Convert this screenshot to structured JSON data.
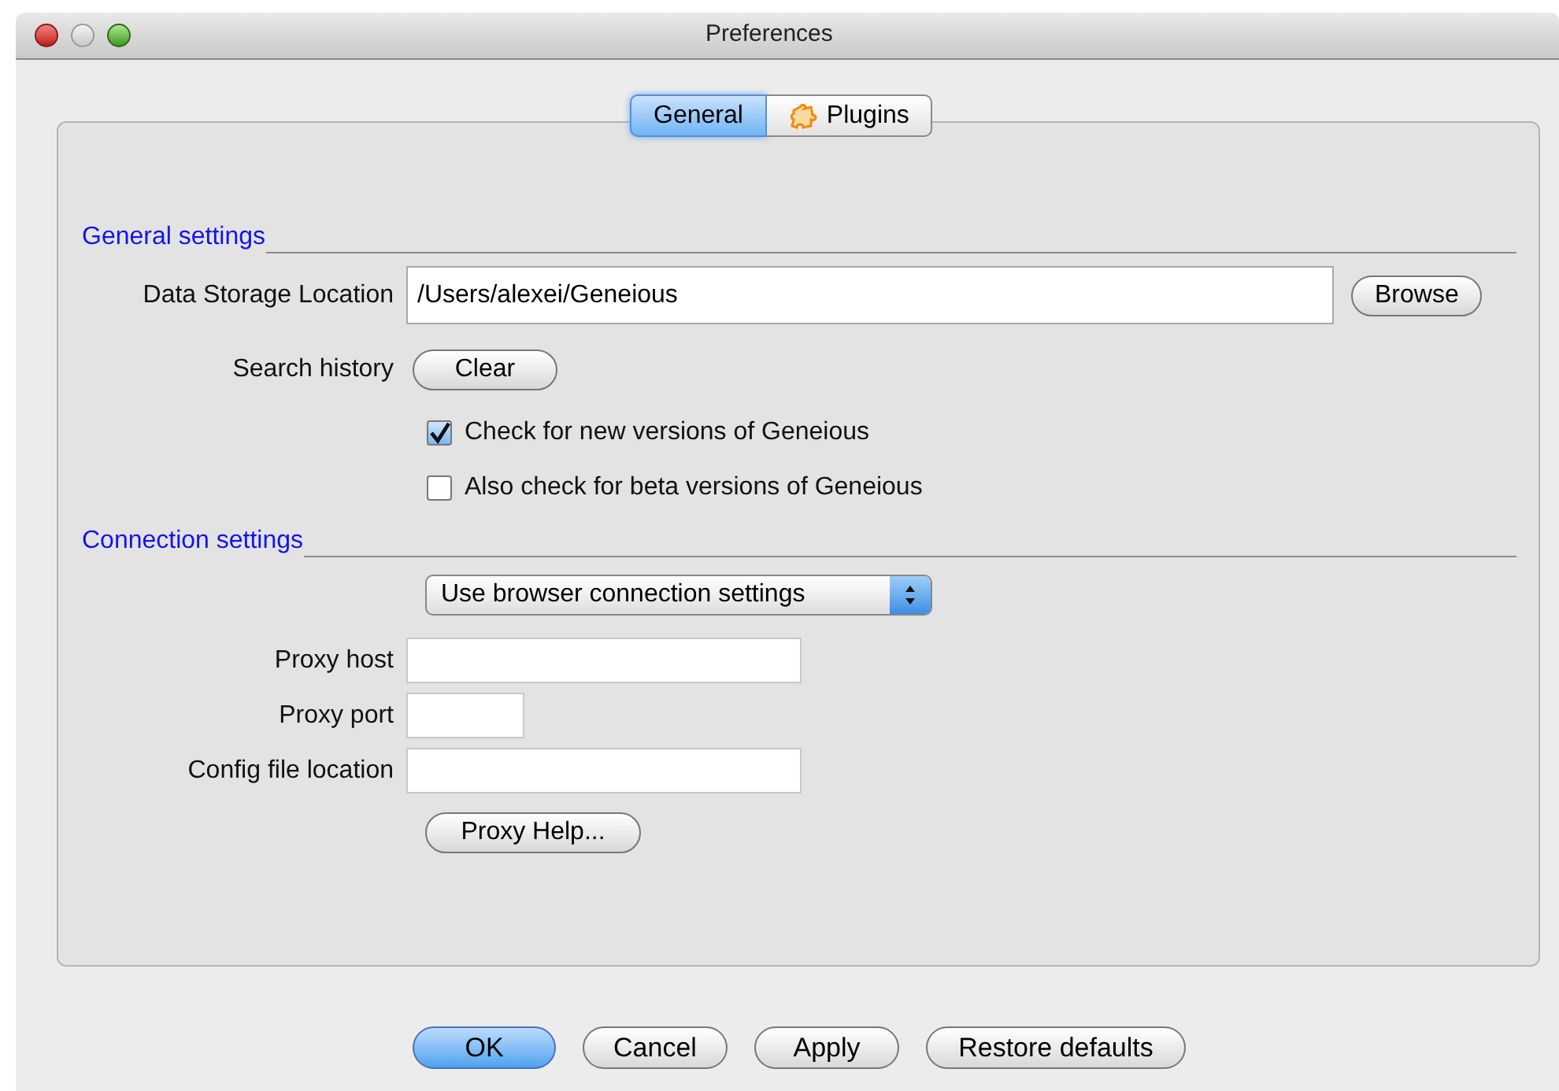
{
  "window": {
    "title": "Preferences"
  },
  "tabs": [
    {
      "label": "General",
      "selected": true,
      "kind": "plain"
    },
    {
      "label": "Plugins",
      "selected": false,
      "kind": "plugin"
    }
  ],
  "general_settings": {
    "heading": "General settings",
    "data_storage": {
      "label": "Data Storage Location",
      "value": "/Users/alexei/Geneious"
    },
    "browse_button": "Browse",
    "search_history": {
      "label": "Search history",
      "button": "Clear"
    },
    "checkboxes": [
      {
        "label": "Check for new versions of Geneious",
        "checked": true
      },
      {
        "label": "Also check for beta versions of Geneious",
        "checked": false
      }
    ]
  },
  "connection_settings": {
    "heading": "Connection settings",
    "mode_dropdown": {
      "value": "Use browser connection settings"
    },
    "fields": [
      {
        "label": "Proxy host",
        "kind": "wide"
      },
      {
        "label": "Proxy port",
        "kind": "short"
      },
      {
        "label": "Config file location",
        "kind": "wide"
      }
    ],
    "help_button": "Proxy Help..."
  },
  "buttons": [
    {
      "label": "OK",
      "default": true
    },
    {
      "label": "Cancel",
      "default": false
    },
    {
      "label": "Apply",
      "default": false
    },
    {
      "label": "Restore defaults",
      "default": false
    }
  ]
}
